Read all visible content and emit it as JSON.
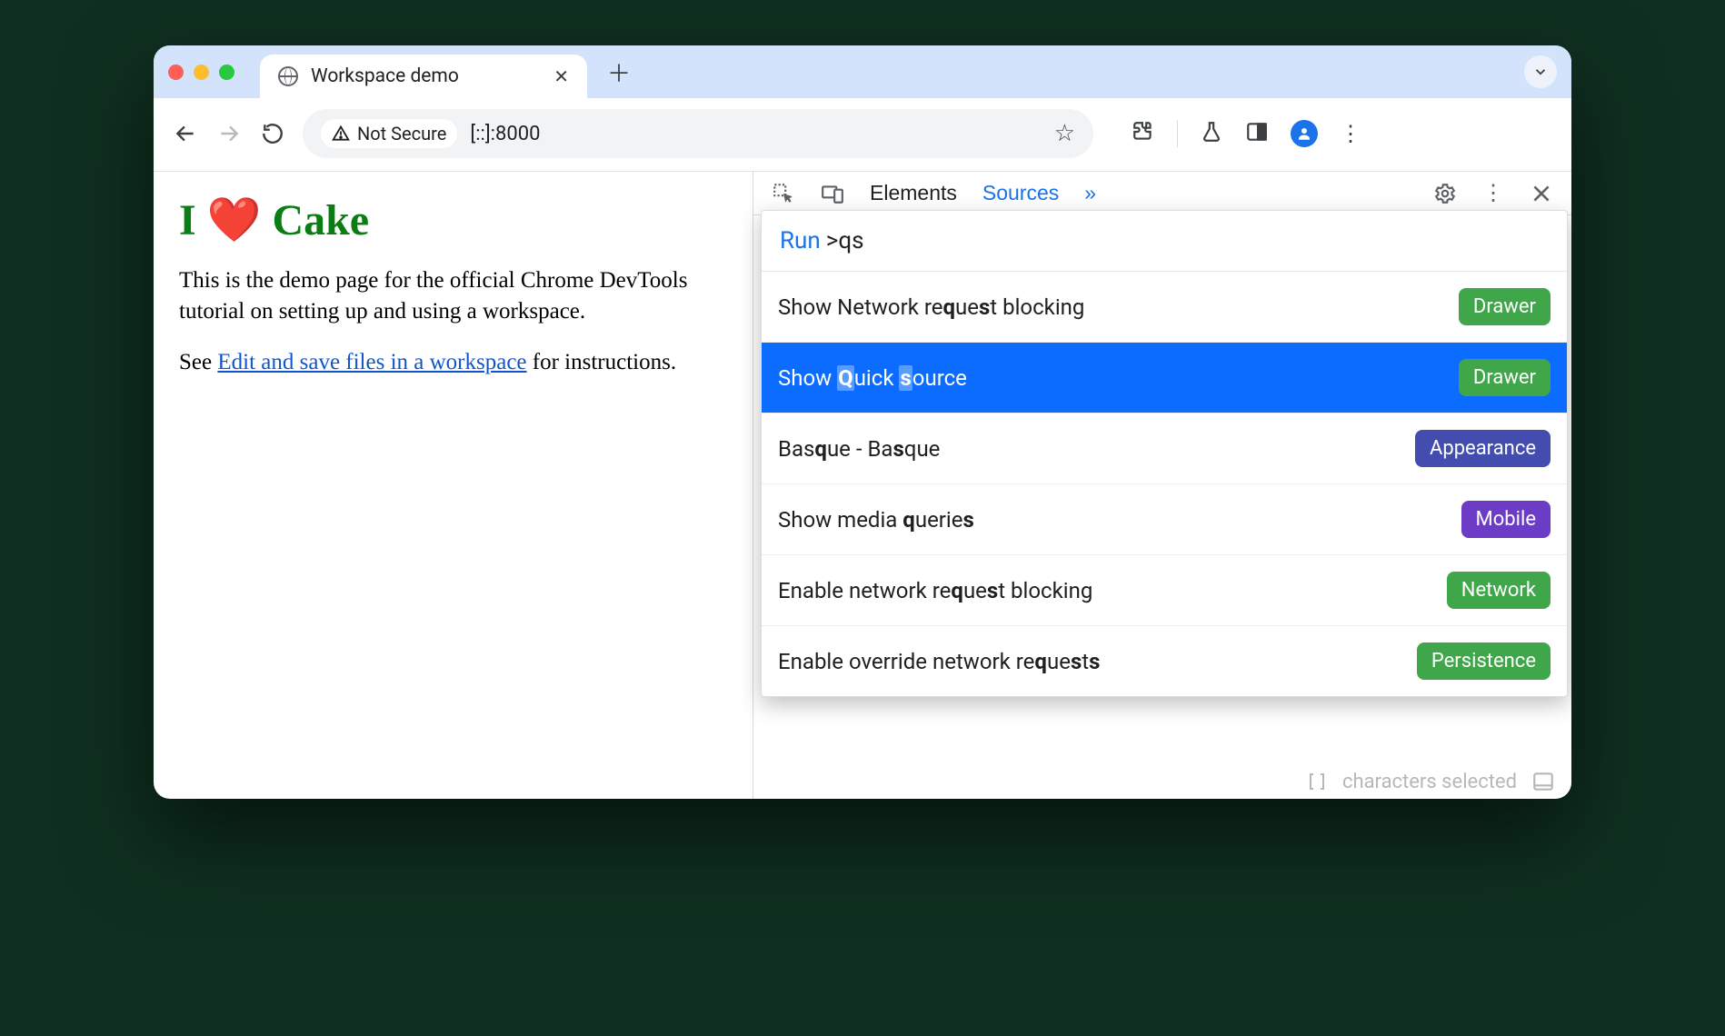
{
  "browser": {
    "tab_title": "Workspace demo",
    "address_security": "Not Secure",
    "address_url": "[::]:8000"
  },
  "page": {
    "heading": "I ❤️ Cake",
    "paragraph1": "This is the demo page for the official Chrome DevTools tutorial on setting up and using a workspace.",
    "paragraph2_prefix": "See ",
    "paragraph2_link": "Edit and save files in a workspace",
    "paragraph2_suffix": " for instructions."
  },
  "devtools": {
    "tabs": {
      "elements": "Elements",
      "sources": "Sources"
    },
    "more_indicator": "»",
    "cmd": {
      "run_label": "Run",
      "query": "qs",
      "items": [
        {
          "label_html": "Show Network re<b>q</b>ue<b>s</b>t blocking",
          "badge": "Drawer",
          "badge_class": "b-drawer",
          "selected": false
        },
        {
          "label_html": "Show <b>Q</b>uick <b>s</b>ource",
          "badge": "Drawer",
          "badge_class": "b-drawer",
          "selected": true
        },
        {
          "label_html": "Bas<b>q</b>ue - Ba<b>s</b>que",
          "badge": "Appearance",
          "badge_class": "b-appearance",
          "selected": false
        },
        {
          "label_html": "Show media <b>q</b>uerie<b>s</b>",
          "badge": "Mobile",
          "badge_class": "b-mobile",
          "selected": false
        },
        {
          "label_html": "Enable network re<b>q</b>ue<b>s</b>t blocking",
          "badge": "Network",
          "badge_class": "b-network",
          "selected": false
        },
        {
          "label_html": "Enable override network re<b>q</b>ue<b>s</b>t<b>s</b>",
          "badge": "Persistence",
          "badge_class": "b-persistence",
          "selected": false
        }
      ]
    },
    "status_text": "characters selected"
  }
}
